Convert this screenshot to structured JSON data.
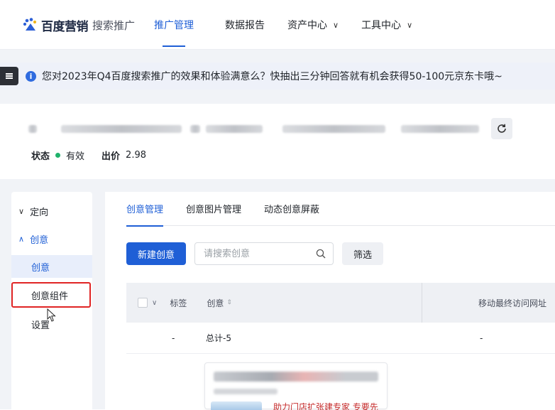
{
  "brand": {
    "logo_text": "百度营销",
    "sub_text": "搜索推广"
  },
  "nav": {
    "items": [
      {
        "label": "推广管理",
        "active": true,
        "dropdown": false
      },
      {
        "label": "数据报告",
        "active": false,
        "dropdown": false
      },
      {
        "label": "资产中心",
        "active": false,
        "dropdown": true
      },
      {
        "label": "工具中心",
        "active": false,
        "dropdown": true
      }
    ]
  },
  "notice": {
    "text": "您对2023年Q4百度搜索推广的效果和体验满意么？快抽出三分钟回答就有机会获得50-100元京东卡哦~"
  },
  "summary": {
    "status_label": "状态",
    "status_value": "有效",
    "bid_label": "出价",
    "bid_value": "2.98"
  },
  "sidebar": {
    "groups": [
      {
        "label": "定向",
        "open": false
      },
      {
        "label": "创意",
        "open": true
      }
    ],
    "items": [
      {
        "label": "创意",
        "active": true
      },
      {
        "label": "创意组件",
        "active": false
      },
      {
        "label": "设置",
        "active": false
      }
    ]
  },
  "tabs": [
    {
      "label": "创意管理",
      "active": true
    },
    {
      "label": "创意图片管理",
      "active": false
    },
    {
      "label": "动态创意屏蔽",
      "active": false
    }
  ],
  "toolbar": {
    "new_button": "新建创意",
    "search_placeholder": "请搜索创意",
    "filter_button": "筛选"
  },
  "table": {
    "columns": {
      "label": "标签",
      "creative": "创意",
      "mobile_url": "移动最终访问网址"
    },
    "total_row": {
      "label": "-",
      "creative": "总计-5",
      "mobile_url": "-"
    },
    "preview_title": "助力门店扩张建专家 专要先"
  },
  "colors": {
    "accent": "#1f5fd6",
    "status_ok": "#20b26b",
    "highlight": "#e02424"
  }
}
